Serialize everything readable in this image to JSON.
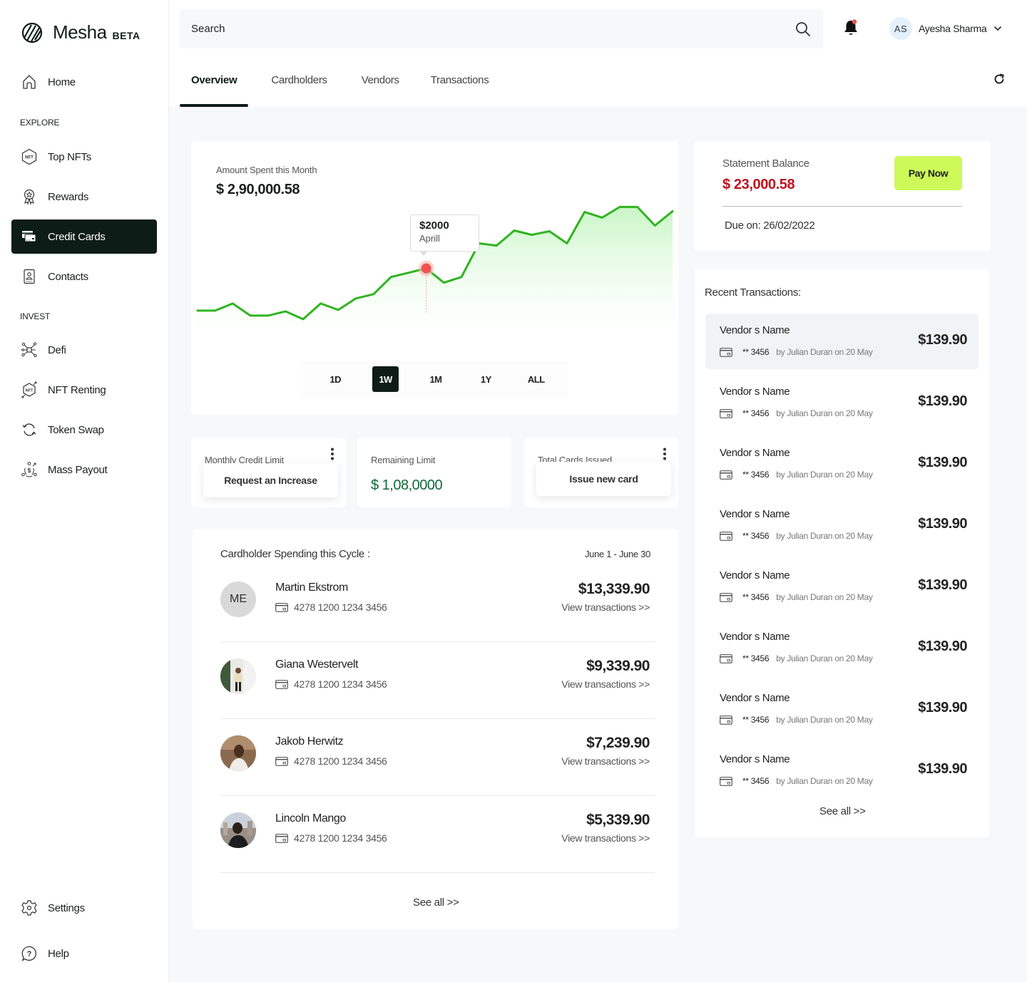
{
  "brand": {
    "name": "Mesha",
    "badge": "BETA"
  },
  "sidebar": {
    "home": "Home",
    "explore_title": "EXPLORE",
    "explore": [
      {
        "label": "Top NFTs",
        "icon": "nft-hexagon-icon"
      },
      {
        "label": "Rewards",
        "icon": "award-ribbon-icon"
      },
      {
        "label": "Credit Cards",
        "icon": "credit-cards-icon",
        "active": true
      },
      {
        "label": "Contacts",
        "icon": "contact-card-icon"
      }
    ],
    "invest_title": "INVEST",
    "invest": [
      {
        "label": "Defi",
        "icon": "network-nodes-icon"
      },
      {
        "label": "NFT Renting",
        "icon": "nft-renting-icon"
      },
      {
        "label": "Token Swap",
        "icon": "swap-cycle-icon"
      },
      {
        "label": "Mass Payout",
        "icon": "payout-icon"
      }
    ],
    "settings": "Settings",
    "help": "Help"
  },
  "header": {
    "search_placeholder": "Search",
    "user_initials": "AS",
    "user_name": "Ayesha Sharma",
    "notification_dot_color": "#f0524f"
  },
  "tabs": [
    "Overview",
    "Cardholders",
    "Vendors",
    "Transactions"
  ],
  "active_tab": "Overview",
  "spend_chart": {
    "label": "Amount Spent this Month",
    "value": "$ 2,90,000.58",
    "tooltip_value": "$2000",
    "tooltip_label": "Aprill",
    "ranges": [
      "1D",
      "1W",
      "1M",
      "1Y",
      "ALL"
    ],
    "active_range": "1W"
  },
  "chart_data": {
    "type": "area",
    "title": "Amount Spent this Month",
    "xlabel": "",
    "ylabel": "",
    "x": [
      0,
      1,
      2,
      3,
      4,
      5,
      6,
      7,
      8,
      9,
      10,
      11,
      12,
      13,
      14,
      15,
      16,
      17,
      18,
      19,
      20,
      21,
      22,
      23,
      24,
      25,
      26,
      27
    ],
    "values": [
      730,
      730,
      946,
      580,
      580,
      710,
      473,
      946,
      753,
      1097,
      1226,
      1742,
      1871,
      2000,
      1570,
      1742,
      2753,
      2688,
      3140,
      3011,
      3118,
      2753,
      3699,
      3527,
      3849,
      3849,
      3290,
      3720
    ],
    "highlight_index": 13,
    "highlight_value": 2000,
    "highlight_label": "Aprill",
    "ylim": [
      0,
      3900
    ],
    "grid": false,
    "line_color": "#2fb41f",
    "highlight_color": "#f0524f"
  },
  "stats": [
    {
      "label": "Monthly Credit Limit",
      "action": "Request an Increase"
    },
    {
      "label": "Remaining Limit",
      "value": "$ 1,08,0000"
    },
    {
      "label": "Total Cards Issued",
      "action": "Issue new card"
    }
  ],
  "cardholders": {
    "title": "Cardholder Spending this Cycle :",
    "date_range": "June 1 - June 30",
    "rows": [
      {
        "initials": "ME",
        "name": "Martin Ekstrom",
        "card": "4278 1200 1234 3456",
        "amount": "$13,339.90",
        "link": "View transactions >>"
      },
      {
        "initials": "",
        "name": "Giana Westervelt",
        "card": "4278 1200 1234 3456",
        "amount": "$9,339.90",
        "link": "View transactions >>"
      },
      {
        "initials": "",
        "name": "Jakob Herwitz",
        "card": "4278 1200 1234 3456",
        "amount": "$7,239.90",
        "link": "View transactions >>"
      },
      {
        "initials": "",
        "name": "Lincoln Mango",
        "card": "4278 1200 1234 3456",
        "amount": "$5,339.90",
        "link": "View transactions >>"
      }
    ],
    "see_all": "See all >>"
  },
  "statement": {
    "label": "Statement Balance",
    "value": "$ 23,000.58",
    "pay_label": "Pay Now",
    "due": "Due on: 26/02/2022"
  },
  "recent": {
    "title": "Recent Transactions:",
    "items": [
      {
        "vendor": "Vendor s Name",
        "card": "** 3456",
        "by": "by Julian Duran on 20 May",
        "amount": "$139.90"
      },
      {
        "vendor": "Vendor s Name",
        "card": "** 3456",
        "by": "by Julian Duran on 20 May",
        "amount": "$139.90"
      },
      {
        "vendor": "Vendor s Name",
        "card": "** 3456",
        "by": "by Julian Duran on 20 May",
        "amount": "$139.90"
      },
      {
        "vendor": "Vendor s Name",
        "card": "** 3456",
        "by": "by Julian Duran on 20 May",
        "amount": "$139.90"
      },
      {
        "vendor": "Vendor s Name",
        "card": "** 3456",
        "by": "by Julian Duran on 20 May",
        "amount": "$139.90"
      },
      {
        "vendor": "Vendor s Name",
        "card": "** 3456",
        "by": "by Julian Duran on 20 May",
        "amount": "$139.90"
      },
      {
        "vendor": "Vendor s Name",
        "card": "** 3456",
        "by": "by Julian Duran on 20 May",
        "amount": "$139.90"
      },
      {
        "vendor": "Vendor s Name",
        "card": "** 3456",
        "by": "by Julian Duran on 20 May",
        "amount": "$139.90"
      }
    ],
    "see_all": "See all >>"
  }
}
